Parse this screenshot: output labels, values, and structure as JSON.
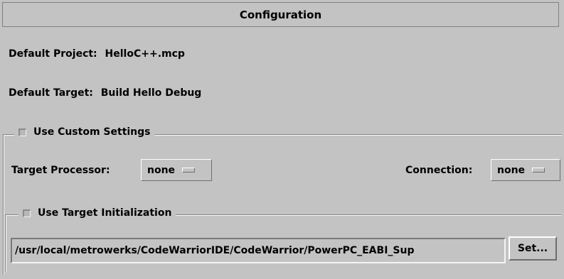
{
  "window": {
    "title": "Configuration"
  },
  "project": {
    "label": "Default Project:",
    "value": "HelloC++.mcp"
  },
  "target": {
    "label": "Default Target:",
    "value": "Build Hello Debug"
  },
  "custom_settings": {
    "checkbox_label": "Use Custom Settings",
    "checked": false,
    "processor_label": "Target Processor:",
    "processor_value": "none",
    "connection_label": "Connection:",
    "connection_value": "none"
  },
  "target_init": {
    "checkbox_label": "Use Target Initialization",
    "checked": false,
    "path_value": "/usr/local/metrowerks/CodeWarriorIDE/CodeWarrior/PowerPC_EABI_Sup",
    "set_button_label": "Set..."
  }
}
